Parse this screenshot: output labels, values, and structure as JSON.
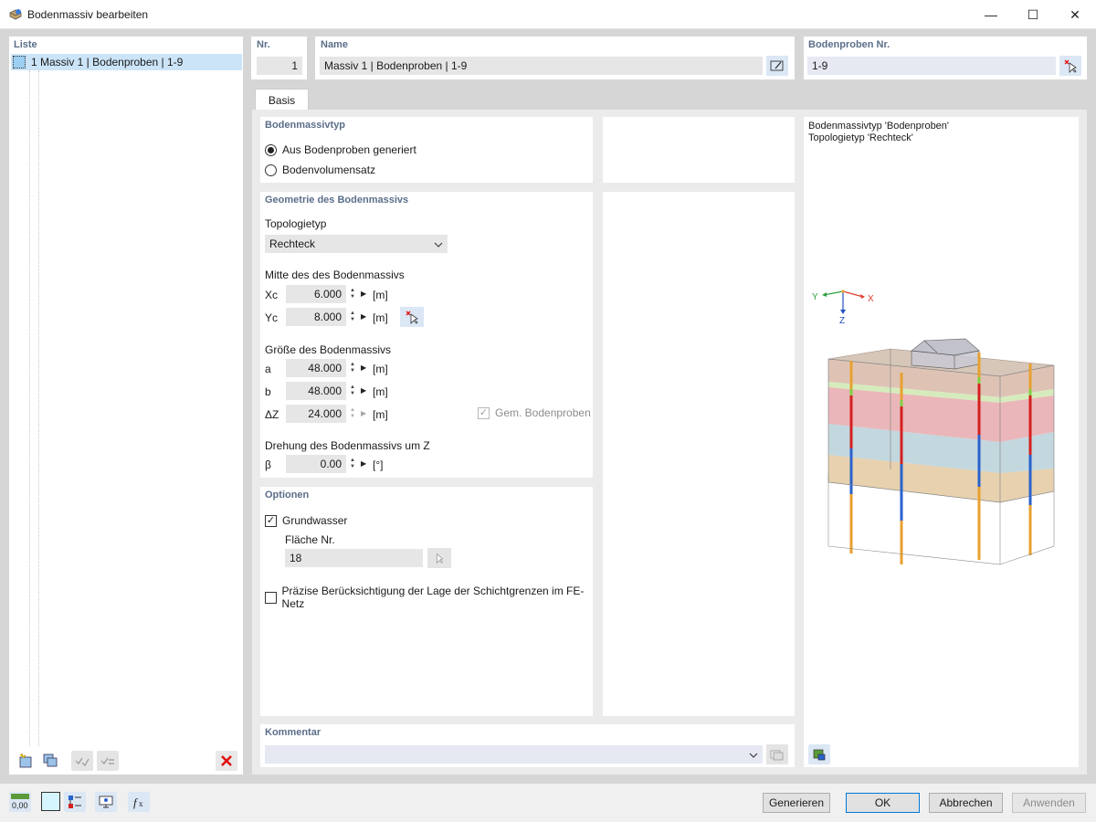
{
  "window": {
    "title": "Bodenmassiv bearbeiten",
    "min": "—",
    "max": "☐",
    "close": "✕"
  },
  "list": {
    "header": "Liste",
    "items": [
      {
        "label": "1  Massiv 1 | Bodenproben | 1-9"
      }
    ]
  },
  "header": {
    "nr_label": "Nr.",
    "nr_value": "1",
    "name_label": "Name",
    "name_value": "Massiv 1 | Bodenproben | 1-9",
    "samples_label": "Bodenproben Nr.",
    "samples_value": "1-9"
  },
  "tabs": [
    {
      "label": "Basis"
    }
  ],
  "type": {
    "title": "Bodenmassivtyp",
    "options": [
      {
        "label": "Aus Bodenproben generiert",
        "selected": true
      },
      {
        "label": "Bodenvolumensatz",
        "selected": false
      }
    ]
  },
  "geometry": {
    "title": "Geometrie des Bodenmassivs",
    "topology_label": "Topologietyp",
    "topology_value": "Rechteck",
    "center_label": "Mitte des des Bodenmassivs",
    "xc": {
      "label": "Xc",
      "value": "6.000",
      "unit": "[m]"
    },
    "yc": {
      "label": "Yc",
      "value": "8.000",
      "unit": "[m]"
    },
    "size_label": "Größe des Bodenmassivs",
    "a": {
      "label": "a",
      "value": "48.000",
      "unit": "[m]"
    },
    "b": {
      "label": "b",
      "value": "48.000",
      "unit": "[m]"
    },
    "dz": {
      "label": "ΔZ",
      "value": "24.000",
      "unit": "[m]"
    },
    "gem_label": "Gem. Bodenproben",
    "rotation_label": "Drehung des Bodenmassivs um Z",
    "beta": {
      "label": "β",
      "value": "0.00",
      "unit": "[°]"
    }
  },
  "options": {
    "title": "Optionen",
    "groundwater_label": "Grundwasser",
    "groundwater_checked": true,
    "surface_label": "Fläche Nr.",
    "surface_value": "18",
    "precise_label": "Präzise Berücksichtigung der Lage der Schichtgrenzen im FE-Netz",
    "precise_checked": false
  },
  "comment": {
    "title": "Kommentar",
    "value": ""
  },
  "preview": {
    "line1": "Bodenmassivtyp 'Bodenproben'",
    "line2": "Topologietyp 'Rechteck'",
    "axis_x": "X",
    "axis_y": "Y",
    "axis_z": "Z"
  },
  "buttons": {
    "generate": "Generieren",
    "ok": "OK",
    "cancel": "Abbrechen",
    "apply": "Anwenden"
  },
  "bottom_toolbar": {
    "units_label": "0,00"
  },
  "colors": {
    "accent": "#5b6e89",
    "selection": "#cce4f7",
    "ok_border": "#0078d7"
  }
}
